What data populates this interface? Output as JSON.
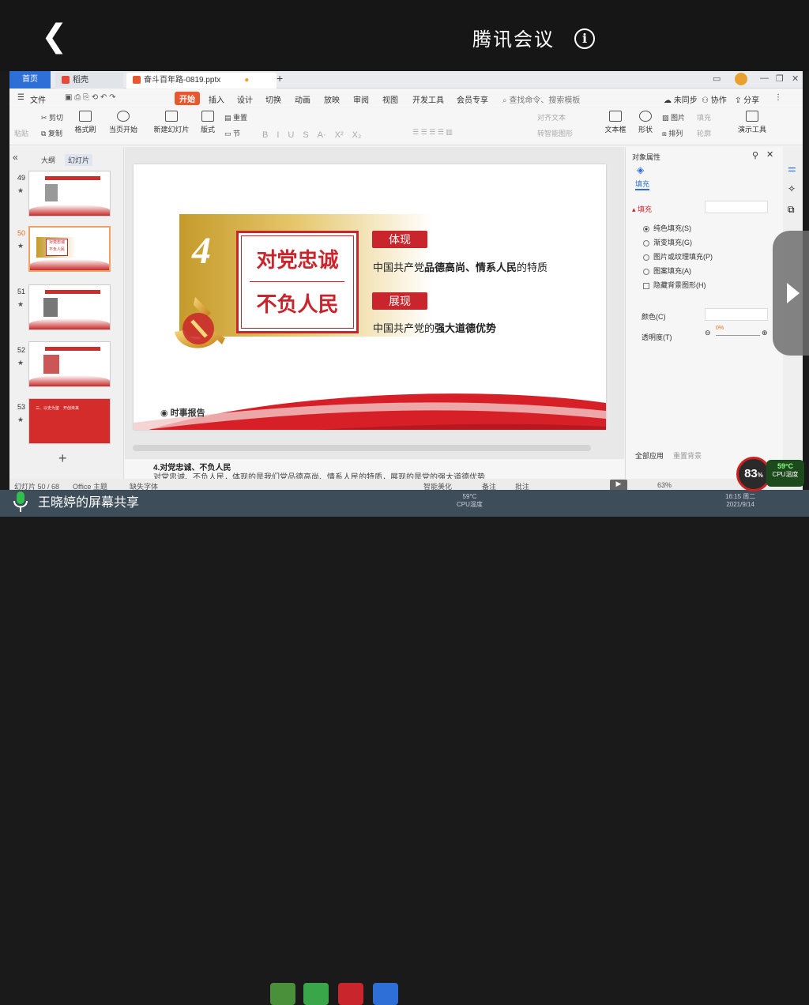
{
  "meeting": {
    "back": "❮",
    "title": "腾讯会议",
    "info": "i"
  },
  "tabs": {
    "home": "首页",
    "docer": "稻壳",
    "doc": "奋斗百年路-0819.pptx",
    "add": "+"
  },
  "menu": [
    "文件",
    "开始",
    "插入",
    "设计",
    "切换",
    "动画",
    "放映",
    "审阅",
    "视图",
    "开发工具",
    "会员专享"
  ],
  "menu_search": "查找命令、搜索模板",
  "menu_right": {
    "sync": "未同步",
    "collab": "协作",
    "share": "分享"
  },
  "ribbon": {
    "cut": "剪切",
    "copy": "复制",
    "paste": "粘贴",
    "format": "格式刷",
    "play": "当页开始",
    "new_slide": "新建幻灯片",
    "layout": "版式",
    "section": "节",
    "reset": "重置",
    "textbox": "文本框",
    "shape": "形状",
    "image": "图片",
    "fill": "填充",
    "arrange": "排列",
    "outline": "轮廓",
    "presenter": "演示工具",
    "align_text": "对齐文本",
    "smart": "转智能图形"
  },
  "slidepane": {
    "outline": "大纲",
    "slides": "幻灯片",
    "collapse": "«",
    "add": "+"
  },
  "thumbs": [
    {
      "num": "49"
    },
    {
      "num": "50"
    },
    {
      "num": "51"
    },
    {
      "num": "52"
    },
    {
      "num": "53"
    }
  ],
  "thumb_texts": {
    "t50a": "对党忠诚",
    "t50b": "不负人民",
    "t53": "三、以史为鉴　开创未来"
  },
  "slide": {
    "number": "4",
    "title1": "对党忠诚",
    "title2": "不负人民",
    "tag1": "体现",
    "text1_pre": "中国共产党",
    "text1_bold": "品德高尚、情系人民",
    "text1_post": "的特质",
    "tag2": "展现",
    "text2_pre": "中国共产党的",
    "text2_bold": "强大道德优势",
    "brand": "时事报告"
  },
  "notes": {
    "line1": "4.对党忠诚、不负人民",
    "line2": "对党忠诚、不负人民，体现的是我们党品德高尚、情系人民的特质，展现的是党的强大道德优势"
  },
  "props": {
    "title": "对象属性",
    "tab": "填充",
    "section": "填充",
    "options": [
      "纯色填充(S)",
      "渐变填充(G)",
      "图片或纹理填充(P)",
      "图案填充(A)"
    ],
    "hide_bg": "隐藏背景图形(H)",
    "color": "颜色(C)",
    "transparency": "透明度(T)",
    "trans_value": "0%",
    "apply_all": "全部应用",
    "reset_bg": "重置背景"
  },
  "status": {
    "slide": "幻灯片 50 / 68",
    "theme": "Office 主题",
    "font": "缺失字体",
    "beautify": "智能美化",
    "notes": "备注",
    "comment": "批注",
    "zoom": "63%"
  },
  "cpu": {
    "percent": "83",
    "unit": "%",
    "temp": "59°C",
    "label": "CPU温度"
  },
  "taskbar": {
    "share": "王晓婷的屏幕共享",
    "temp": "59°C",
    "cpu": "CPU温度",
    "time": "16:15 周二",
    "date": "2021/9/14"
  }
}
